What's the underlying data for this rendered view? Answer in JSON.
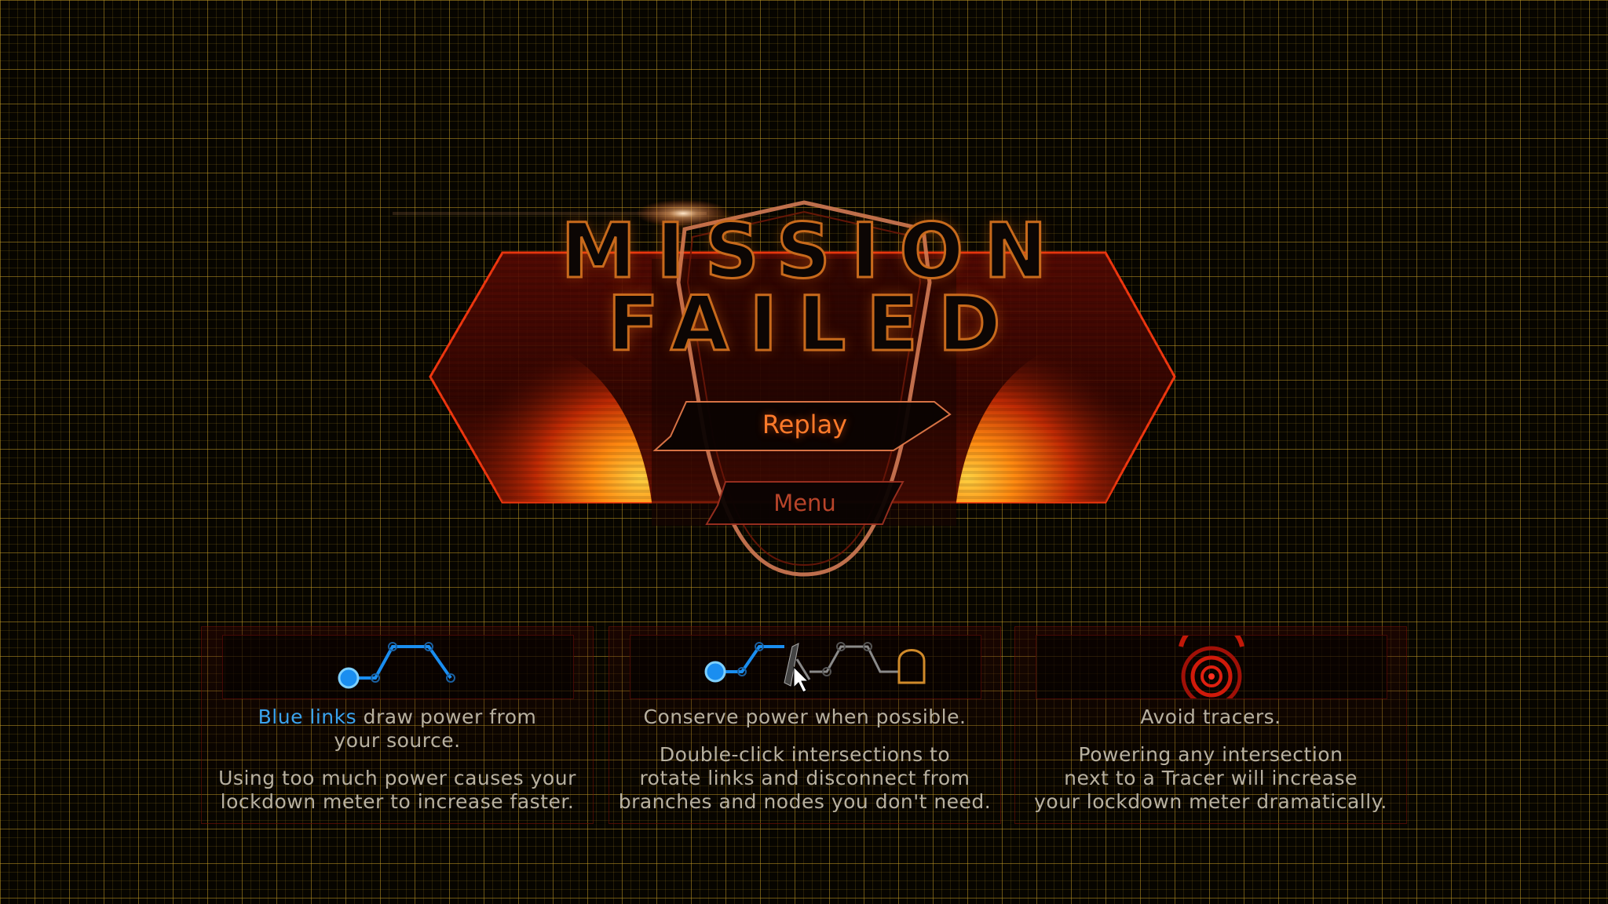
{
  "title": {
    "line1": "MISSION",
    "line2": "FAILED"
  },
  "buttons": {
    "replay_label": "Replay",
    "menu_label": "Menu"
  },
  "tips": [
    {
      "icon": "blue-link-icon",
      "head_highlight": "Blue links",
      "head_rest": " draw power from",
      "head_line2": "your source.",
      "body_line1": "Using too much power causes your",
      "body_line2": "lockdown meter to increase faster."
    },
    {
      "icon": "rotate-link-icon",
      "head_line1": "Conserve power when possible.",
      "body_line1": "Double-click intersections to",
      "body_line2": "rotate links and disconnect from",
      "body_line3": "branches and nodes you don't need."
    },
    {
      "icon": "tracer-icon",
      "head_line1": "Avoid tracers.",
      "body_line1": "Powering any intersection",
      "body_line2": "next to a Tracer will increase",
      "body_line3": "your lockdown meter dramatically."
    }
  ],
  "colors": {
    "accent_orange": "#ff7a2a",
    "link_blue": "#3aa3ee",
    "grid": "#c8a028",
    "text": "#b7b0a0"
  }
}
